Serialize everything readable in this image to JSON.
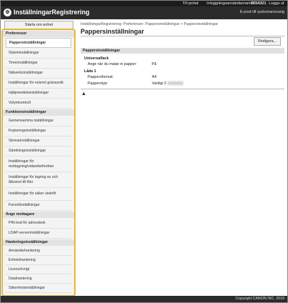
{
  "topbar": {
    "portal": "Till portal",
    "login_label": "Inloggningsanvändarnamn:",
    "user_id": "7654321",
    "logout": "Logga ut"
  },
  "header": {
    "title": "InställningarRegistrering",
    "remote_link": "E-post till systemansvarig"
  },
  "sidebar": {
    "home": "Starta om enhet",
    "sections": [
      {
        "title": "Preferenser",
        "items": [
          "Pappersinställningar",
          "Skärminställningar",
          "Timerinställningar",
          "Nätverksinställningar",
          "Inställningar för externt gränssnitt",
          "Hjälpmedelsinställningar",
          "Volymkontroll"
        ]
      },
      {
        "title": "Funktionsinställningar",
        "items": [
          "Gemensamma inställningar",
          "Kopieringsinställningar",
          "Skrivarinställningar",
          "Sändningsinställningar",
          "Inställningar för mottagning/vidarebefordran",
          "Inställningar för lagring av och åtkomst till filer",
          "Inställningar för säker utskrift",
          "Favoritinställningar"
        ]
      },
      {
        "title": "Ange mottagare",
        "items": [
          "PIN-kod för adressbok",
          "LDAP-serverinställningar"
        ]
      },
      {
        "title": "Hanteringsinställningar",
        "items": [
          "Användarhantering",
          "Enhetshantering",
          "Licens/övrigt",
          "Datahantering",
          "Säkerhetsinställningar"
        ]
      }
    ]
  },
  "main": {
    "breadcrumb": "InställningarRegistrering: Preferenser: Pappersinställningar > Pappersinställningar",
    "title": "Pappersinställningar",
    "edit_button": "Redigera...",
    "section_title": "Pappersinställningar",
    "group1_title": "Universalfack",
    "row1_label": "Ange när du matar in papper:",
    "row1_value": "På",
    "group2_title": "Låda 1",
    "row2_label": "Pappersformat:",
    "row2_value": "A4",
    "row3_label": "Papperstyp:",
    "row3_value": "Vanligt 2"
  },
  "footer": {
    "copyright": "Copyright CANON INC. 2018"
  }
}
